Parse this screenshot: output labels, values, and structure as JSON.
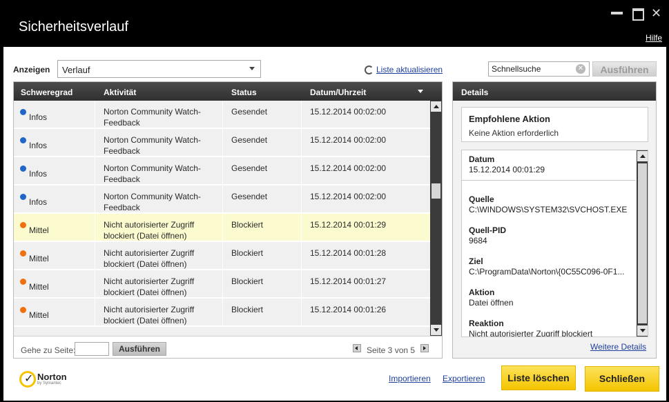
{
  "window": {
    "title": "Sicherheitsverlauf",
    "help_link": "Hilfe"
  },
  "toolbar": {
    "show_label": "Anzeigen",
    "show_value": "Verlauf",
    "refresh_link": "Liste aktualisieren",
    "search_placeholder": "Schnellsuche",
    "search_button": "Ausführen"
  },
  "table": {
    "columns": [
      "Schweregrad",
      "Aktivität",
      "Status",
      "Datum/Uhrzeit"
    ],
    "rows": [
      {
        "severity": "Infos",
        "severity_color": "#2165c9",
        "activity_line1": "Norton Community Watch-",
        "activity_line2": "Feedback",
        "status": "Gesendet",
        "datetime": "15.12.2014 00:02:00",
        "highlight": false
      },
      {
        "severity": "Infos",
        "severity_color": "#2165c9",
        "activity_line1": "Norton Community Watch-",
        "activity_line2": "Feedback",
        "status": "Gesendet",
        "datetime": "15.12.2014 00:02:00",
        "highlight": false
      },
      {
        "severity": "Infos",
        "severity_color": "#2165c9",
        "activity_line1": "Norton Community Watch-",
        "activity_line2": "Feedback",
        "status": "Gesendet",
        "datetime": "15.12.2014 00:02:00",
        "highlight": false
      },
      {
        "severity": "Infos",
        "severity_color": "#2165c9",
        "activity_line1": "Norton Community Watch-",
        "activity_line2": "Feedback",
        "status": "Gesendet",
        "datetime": "15.12.2014 00:02:00",
        "highlight": false
      },
      {
        "severity": "Mittel",
        "severity_color": "#f06f0f",
        "activity_line1": "Nicht autorisierter Zugriff",
        "activity_line2": "blockiert (Datei öffnen)",
        "status": "Blockiert",
        "datetime": "15.12.2014 00:01:29",
        "highlight": true
      },
      {
        "severity": "Mittel",
        "severity_color": "#f06f0f",
        "activity_line1": "Nicht autorisierter Zugriff",
        "activity_line2": "blockiert (Datei öffnen)",
        "status": "Blockiert",
        "datetime": "15.12.2014 00:01:28",
        "highlight": false
      },
      {
        "severity": "Mittel",
        "severity_color": "#f06f0f",
        "activity_line1": "Nicht autorisierter Zugriff",
        "activity_line2": "blockiert (Datei öffnen)",
        "status": "Blockiert",
        "datetime": "15.12.2014 00:01:27",
        "highlight": false
      },
      {
        "severity": "Mittel",
        "severity_color": "#f06f0f",
        "activity_line1": "Nicht autorisierter Zugriff",
        "activity_line2": "blockiert (Datei öffnen)",
        "status": "Blockiert",
        "datetime": "15.12.2014 00:01:26",
        "highlight": false
      }
    ],
    "goto_label": "Gehe zu Seite:",
    "goto_button": "Ausführen",
    "page_label": "Seite 3 von 5"
  },
  "details": {
    "header": "Details",
    "recommended_title": "Empfohlene Aktion",
    "recommended_text": "Keine Aktion erforderlich",
    "items": [
      {
        "key": "Datum",
        "value": "15.12.2014 00:01:29"
      },
      {
        "key": "Quelle",
        "value": "C:\\WINDOWS\\SYSTEM32\\SVCHOST.EXE"
      },
      {
        "key": "Quell-PID",
        "value": "9684"
      },
      {
        "key": "Ziel",
        "value": "C:\\ProgramData\\Norton\\{0C55C096-0F1..."
      },
      {
        "key": "Aktion",
        "value": "Datei öffnen"
      },
      {
        "key": "Reaktion",
        "value": "Nicht autorisierter Zugriff blockiert"
      }
    ],
    "more_link": "Weitere Details"
  },
  "footer": {
    "brand": "Norton",
    "brand_sub": "by Symantec",
    "import_link": "Importieren",
    "export_link": "Exportieren",
    "clear_button": "Liste löschen",
    "close_button": "Schließen"
  },
  "colors": {
    "accent_yellow": "#f4c400",
    "link_blue": "#1e3e9e",
    "header_dark": "#3a3a3a"
  }
}
